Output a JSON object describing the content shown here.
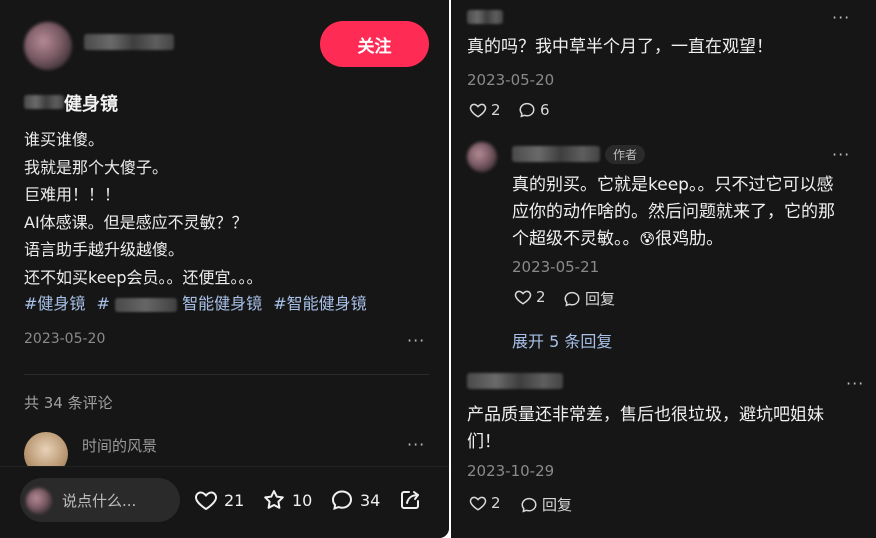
{
  "post": {
    "follow_label": "关注",
    "title": "健身镜",
    "body_lines": [
      "谁买谁傻。",
      "我就是那个大傻子。",
      "巨难用！！！",
      "AI体感课。但是感应不灵敏？？",
      "语言助手越升级越傻。",
      "还不如买keep会员。。还便宜。。。"
    ],
    "tags": [
      "#健身镜",
      "#",
      "智能健身镜",
      "#智能健身镜"
    ],
    "date": "2023-05-20",
    "more": "···",
    "comment_count": "共 34 条评论",
    "preview_commenter": "时间的风景"
  },
  "bottom_bar": {
    "input_placeholder": "说点什么...",
    "likes": "21",
    "favorites": "10",
    "comments": "34"
  },
  "comments": [
    {
      "text": "真的吗？我中草半个月了，一直在观望！",
      "date": "2023-05-20",
      "likes": "2",
      "replies": "6"
    },
    {
      "badge": "作者",
      "text_lines": [
        "真的别买。它就是keep。。只不过它可以感",
        "应你的动作啥的。然后问题就来了，它的那",
        "个超级不灵敏。。",
        "很鸡肋。"
      ],
      "emoji": "😰",
      "date": "2023-05-21",
      "likes": "2",
      "reply_label": "回复"
    },
    {
      "expand_label": "展开 5 条回复"
    },
    {
      "text_lines": [
        "产品质量还非常差，售后也很垃圾，避坑吧姐妹",
        "们！"
      ],
      "date": "2023-10-29",
      "likes": "2",
      "reply_label": "回复"
    }
  ],
  "colors": {
    "accent": "#fe2c55",
    "tag": "#a8c0e8",
    "background": "#161616"
  }
}
